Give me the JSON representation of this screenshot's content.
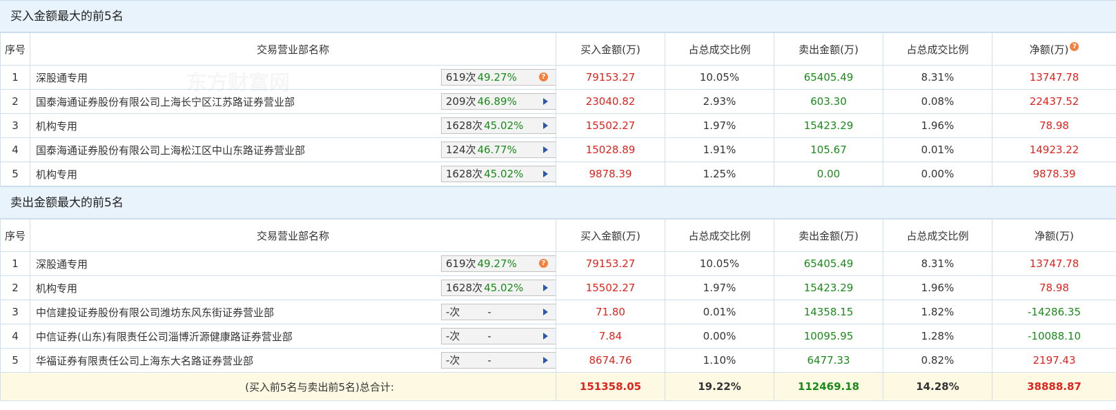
{
  "buy_section": {
    "title": "买入金额最大的前5名",
    "headers": [
      "序号",
      "交易营业部名称",
      "买入金额(万)",
      "占总成交比例",
      "卖出金额(万)",
      "占总成交比例",
      "净额(万)"
    ],
    "rows": [
      {
        "idx": "1",
        "name": "深股通专用",
        "times": "619次",
        "rate": "49.27%",
        "icon": "help-icon",
        "buy": "79153.27",
        "buy_pct": "10.05%",
        "sell": "65405.49",
        "sell_pct": "8.31%",
        "net": "13747.78"
      },
      {
        "idx": "2",
        "name": "国泰海通证券股份有限公司上海长宁区江苏路证券营业部",
        "times": "209次",
        "rate": "46.89%",
        "icon": "arrow-right-icon",
        "buy": "23040.82",
        "buy_pct": "2.93%",
        "sell": "603.30",
        "sell_pct": "0.08%",
        "net": "22437.52"
      },
      {
        "idx": "3",
        "name": "机构专用",
        "times": "1628次",
        "rate": "45.02%",
        "icon": "arrow-right-icon",
        "buy": "15502.27",
        "buy_pct": "1.97%",
        "sell": "15423.29",
        "sell_pct": "1.96%",
        "net": "78.98"
      },
      {
        "idx": "4",
        "name": "国泰海通证券股份有限公司上海松江区中山东路证券营业部",
        "times": "124次",
        "rate": "46.77%",
        "icon": "arrow-right-icon",
        "buy": "15028.89",
        "buy_pct": "1.91%",
        "sell": "105.67",
        "sell_pct": "0.01%",
        "net": "14923.22"
      },
      {
        "idx": "5",
        "name": "机构专用",
        "times": "1628次",
        "rate": "45.02%",
        "icon": "arrow-right-icon",
        "buy": "9878.39",
        "buy_pct": "1.25%",
        "sell": "0.00",
        "sell_pct": "0.00%",
        "net": "9878.39"
      }
    ]
  },
  "sell_section": {
    "title": "卖出金额最大的前5名",
    "headers": [
      "序号",
      "交易营业部名称",
      "买入金额(万)",
      "占总成交比例",
      "卖出金额(万)",
      "占总成交比例",
      "净额(万)"
    ],
    "rows": [
      {
        "idx": "1",
        "name": "深股通专用",
        "times": "619次",
        "rate": "49.27%",
        "icon": "help-icon",
        "buy": "79153.27",
        "buy_pct": "10.05%",
        "sell": "65405.49",
        "sell_pct": "8.31%",
        "net": "13747.78"
      },
      {
        "idx": "2",
        "name": "机构专用",
        "times": "1628次",
        "rate": "45.02%",
        "icon": "arrow-right-icon",
        "buy": "15502.27",
        "buy_pct": "1.97%",
        "sell": "15423.29",
        "sell_pct": "1.96%",
        "net": "78.98"
      },
      {
        "idx": "3",
        "name": "中信建投证券股份有限公司潍坊东风东街证券营业部",
        "times": "-次",
        "rate": "-",
        "icon": "arrow-right-icon",
        "buy": "71.80",
        "buy_pct": "0.01%",
        "sell": "14358.15",
        "sell_pct": "1.82%",
        "net": "-14286.35"
      },
      {
        "idx": "4",
        "name": "中信证券(山东)有限责任公司淄博沂源健康路证券营业部",
        "times": "-次",
        "rate": "-",
        "icon": "arrow-right-icon",
        "buy": "7.84",
        "buy_pct": "0.00%",
        "sell": "10095.95",
        "sell_pct": "1.28%",
        "net": "-10088.10"
      },
      {
        "idx": "5",
        "name": "华福证券有限责任公司上海东大名路证券营业部",
        "times": "-次",
        "rate": "-",
        "icon": "arrow-right-icon",
        "buy": "8674.76",
        "buy_pct": "1.10%",
        "sell": "6477.33",
        "sell_pct": "0.82%",
        "net": "2197.43"
      }
    ]
  },
  "total": {
    "label": "(买入前5名与卖出前5名)总合计:",
    "buy": "151358.05",
    "buy_pct": "19.22%",
    "sell": "112469.18",
    "sell_pct": "14.28%",
    "net": "38888.87"
  },
  "watermark": {
    "text": "东方财富网"
  },
  "colors": {
    "positive": "#e0231d",
    "sell": "#1a8a1a",
    "header_bg": "#e9f3fb",
    "total_bg": "#fdf9e3"
  }
}
